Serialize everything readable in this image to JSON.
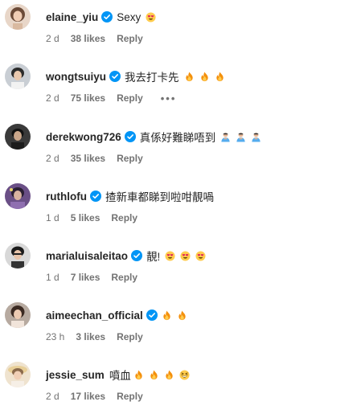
{
  "comments": [
    {
      "username": "elaine_yiu",
      "verified": true,
      "text": "Sexy",
      "emojis": [
        "heart-eyes-emoji"
      ],
      "time": "2 d",
      "likes": "38 likes",
      "reply": "Reply",
      "show_more": false
    },
    {
      "username": "wongtsuiyu",
      "verified": true,
      "text": "我去打卡先",
      "emojis": [
        "fire-emoji",
        "fire-emoji",
        "fire-emoji"
      ],
      "time": "2 d",
      "likes": "75 likes",
      "reply": "Reply",
      "show_more": true,
      "more_label": "•••"
    },
    {
      "username": "derekwong726",
      "verified": true,
      "text": "真係好難睇唔到",
      "emojis": [
        "person-bowing-emoji",
        "person-bowing-emoji",
        "person-bowing-emoji"
      ],
      "time": "2 d",
      "likes": "35 likes",
      "reply": "Reply",
      "show_more": false
    },
    {
      "username": "ruthlofu",
      "verified": true,
      "text": "揸新車都睇到啦咁靚喎",
      "emojis": [],
      "time": "1 d",
      "likes": "5 likes",
      "reply": "Reply",
      "show_more": false
    },
    {
      "username": "marialuisaleitao",
      "verified": true,
      "text": "靚!",
      "emojis": [
        "heart-eyes-emoji",
        "heart-eyes-emoji",
        "heart-eyes-emoji"
      ],
      "time": "1 d",
      "likes": "7 likes",
      "reply": "Reply",
      "show_more": false
    },
    {
      "username": "aimeechan_official",
      "verified": true,
      "text": "",
      "emojis": [
        "fire-emoji",
        "fire-emoji"
      ],
      "time": "23 h",
      "likes": "3 likes",
      "reply": "Reply",
      "show_more": false
    },
    {
      "username": "jessie_sum",
      "verified": false,
      "text": "噴血",
      "emojis": [
        "fire-emoji",
        "fire-emoji",
        "fire-emoji",
        "grinning-squinting-emoji"
      ],
      "time": "2 d",
      "likes": "17 likes",
      "reply": "Reply",
      "show_more": false
    }
  ],
  "colors": {
    "text": "#262626",
    "secondary": "#737373",
    "verified_blue": "#0095f6"
  }
}
